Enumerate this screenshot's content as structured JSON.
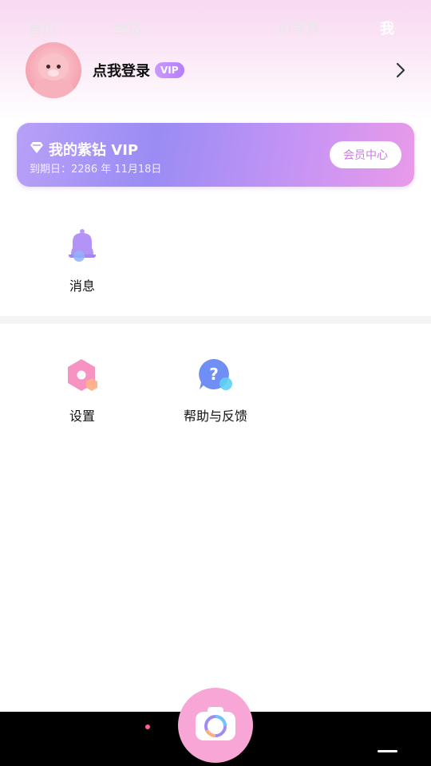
{
  "profile": {
    "login_label": "点我登录",
    "vip_tag": "VIP"
  },
  "vip_card": {
    "title": "我的紫钻 VIP",
    "expire_text": "到期日：2286 年 11月18日",
    "member_center_label": "会员中心"
  },
  "tiles": {
    "messages_label": "消息",
    "settings_label": "设置",
    "help_label": "帮助与反馈"
  },
  "bottom_nav": {
    "home": "首页",
    "member": "会员",
    "ai_photo": "AI写真",
    "me": "我"
  },
  "icons": {
    "avatar": "seal-avatar",
    "chevron": "chevron-right-icon",
    "diamond": "diamond-icon",
    "bell": "bell-icon",
    "settings": "hexagon-gear-icon",
    "help": "question-bubble-icon",
    "camera": "camera-icon"
  },
  "colors": {
    "vip_accent": "#b77dfb",
    "member_center_text": "#c57fe0",
    "camera_bg": "#f7a6d6",
    "nav_dot": "#ff5fa2"
  }
}
